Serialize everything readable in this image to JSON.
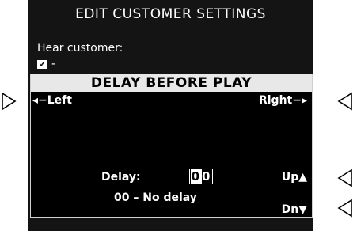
{
  "screen": {
    "header": "EDIT CUSTOMER SETTINGS",
    "background": {
      "hear_customer_label": "Hear customer:",
      "checkbox_mark": "✔",
      "dash": "-"
    },
    "dialog": {
      "title": "DELAY BEFORE PLAY",
      "left_key": "◂−Left",
      "right_key": "Right−▸",
      "up_key": "Up▲",
      "down_key": "Dn▼",
      "delay_label": "Delay:",
      "delay_digit_1": "0",
      "delay_digit_2": "0",
      "delay_note": "00 – No delay"
    }
  },
  "pointers": [
    "pointer-triangle-icon",
    "pointer-triangle-icon",
    "pointer-triangle-icon",
    "pointer-triangle-icon"
  ],
  "colors": {
    "screen_bg": "#141414",
    "title_bar": "#e8e8e8",
    "text": "#ffffff"
  }
}
